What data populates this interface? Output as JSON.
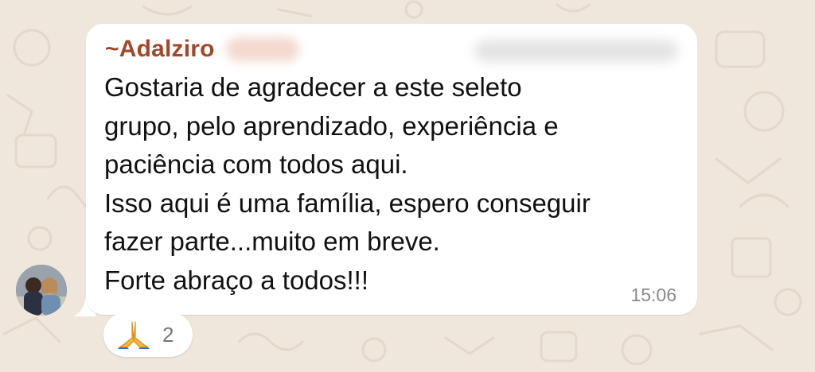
{
  "message": {
    "sender_prefix": "~ ",
    "sender_name": "Adalziro",
    "lines": [
      "Gostaria de agradecer a este seleto",
      "grupo, pelo aprendizado, experiência e",
      "paciência com todos aqui.",
      "Isso aqui é uma família, espero conseguir",
      "fazer parte...muito em breve.",
      "Forte abraço a todos!!!"
    ],
    "time": "15:06"
  },
  "reaction": {
    "icon": "folded-hands-icon",
    "count": "2"
  },
  "colors": {
    "chat_background": "#efe7dc",
    "bubble": "#ffffff",
    "sender_name": "#a1472a",
    "timestamp": "#8a8a8a"
  }
}
